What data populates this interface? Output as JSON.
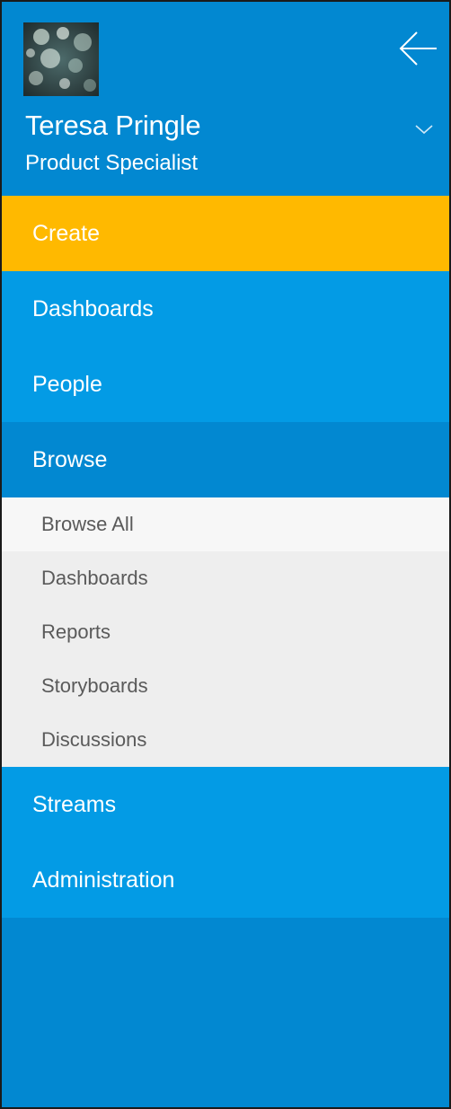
{
  "profile": {
    "name": "Teresa Pringle",
    "role": "Product Specialist"
  },
  "nav": {
    "create": "Create",
    "dashboards": "Dashboards",
    "people": "People",
    "browse": "Browse",
    "streams": "Streams",
    "administration": "Administration"
  },
  "browse_submenu": [
    {
      "label": "Browse All",
      "active": true
    },
    {
      "label": "Dashboards"
    },
    {
      "label": "Reports"
    },
    {
      "label": "Storyboards"
    },
    {
      "label": "Discussions"
    }
  ],
  "icons": {
    "back": "arrow-left-icon",
    "expand": "chevron-down-icon"
  },
  "colors": {
    "header_bg": "#0288d1",
    "nav_bg": "#039be5",
    "create_bg": "#ffb900",
    "submenu_bg": "#eeeeee",
    "submenu_active_bg": "#f7f7f7",
    "submenu_text": "#5a5a5a"
  }
}
